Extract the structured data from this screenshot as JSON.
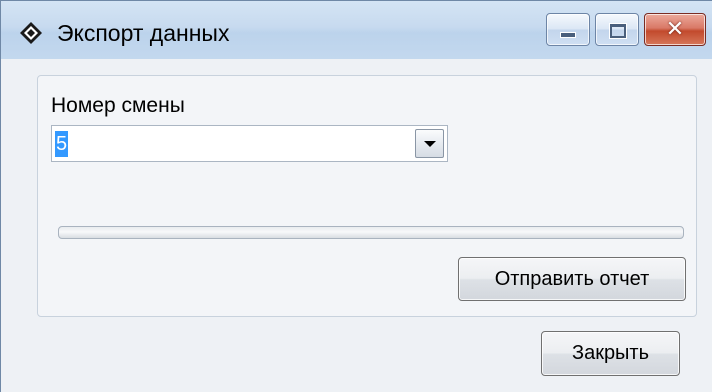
{
  "window": {
    "title": "Экспорт данных",
    "icon": "diamond-app-icon",
    "controls": {
      "minimize_icon": "minimize-icon",
      "maximize_icon": "maximize-icon",
      "close_icon": "close-icon",
      "close_glyph": "✕"
    }
  },
  "form": {
    "shift_label": "Номер смены",
    "shift_value": "5",
    "dropdown_icon": "chevron-down-icon",
    "progress_percent": 0,
    "send_button": "Отправить отчет"
  },
  "footer": {
    "close_button": "Закрыть"
  },
  "colors": {
    "selection": "#3399ff",
    "close_button_red": "#c24a2d",
    "titlebar": "#c7daef"
  }
}
